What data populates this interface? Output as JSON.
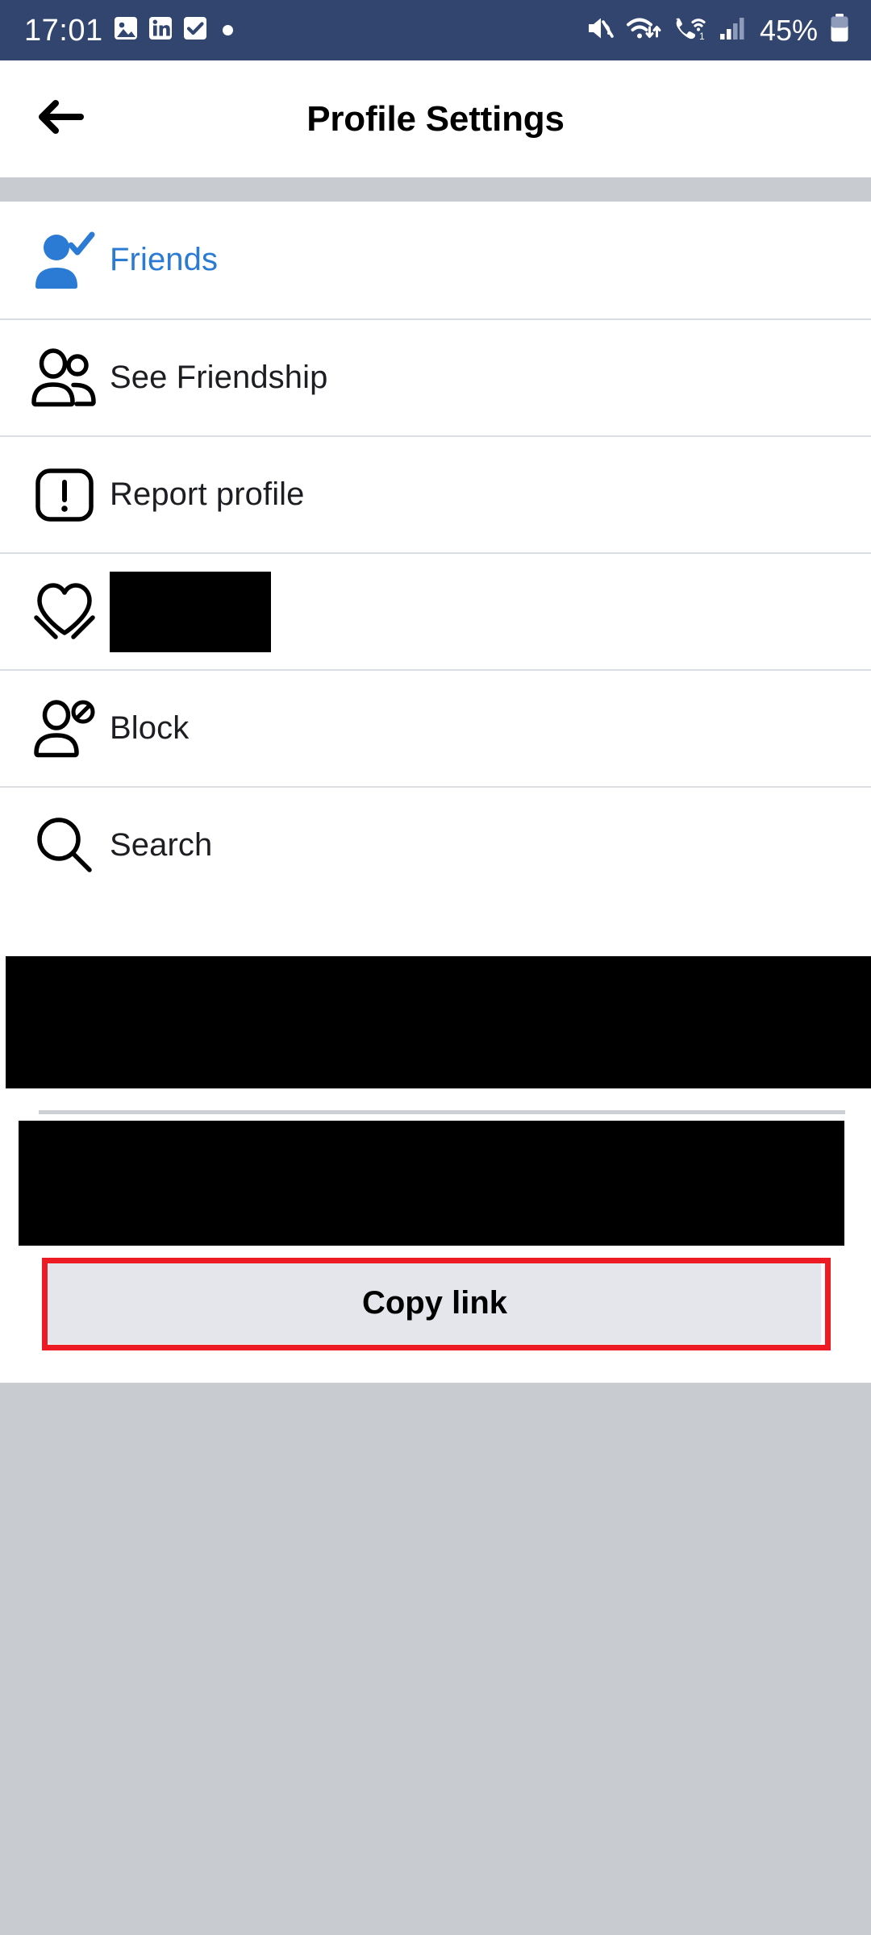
{
  "status_bar": {
    "time": "17:01",
    "battery_percent": "45%",
    "background_color": "#31456f",
    "notification_icons": [
      "photo-icon",
      "linkedin-icon",
      "checkbox-icon",
      "dot-indicator-icon"
    ],
    "system_icons": [
      "volume-mute-icon",
      "wifi-data-transfer-icon",
      "wifi-calling-1-icon",
      "cellular-signal-icon",
      "battery-icon"
    ]
  },
  "header": {
    "title": "Profile Settings",
    "back_icon": "back-arrow-icon"
  },
  "menu": {
    "items": [
      {
        "label": "Friends",
        "icon": "person-check-filled-icon",
        "accent": true,
        "redacted": false
      },
      {
        "label": "See Friendship",
        "icon": "two-people-outline-icon",
        "accent": false,
        "redacted": false
      },
      {
        "label": "Report profile",
        "icon": "report-exclamation-icon",
        "accent": false,
        "redacted": false
      },
      {
        "label": "",
        "icon": "heart-hands-icon",
        "accent": false,
        "redacted": true
      },
      {
        "label": "Block",
        "icon": "person-block-icon",
        "accent": false,
        "redacted": false
      },
      {
        "label": "Search",
        "icon": "search-magnifier-icon",
        "accent": false,
        "redacted": false
      }
    ]
  },
  "share_panel": {
    "redacted_row_1": "",
    "redacted_row_2": "",
    "copy_link_label": "Copy link"
  },
  "colors": {
    "status_bar": "#31456f",
    "accent_blue": "#2b7bd4",
    "page_background": "#c8ccd1",
    "surface": "#ffffff",
    "divider": "#dadde1",
    "button_fill": "#e4e6eb",
    "highlight_outline": "#ed1c24",
    "redaction": "#000000",
    "text_primary": "#1c1e21"
  }
}
